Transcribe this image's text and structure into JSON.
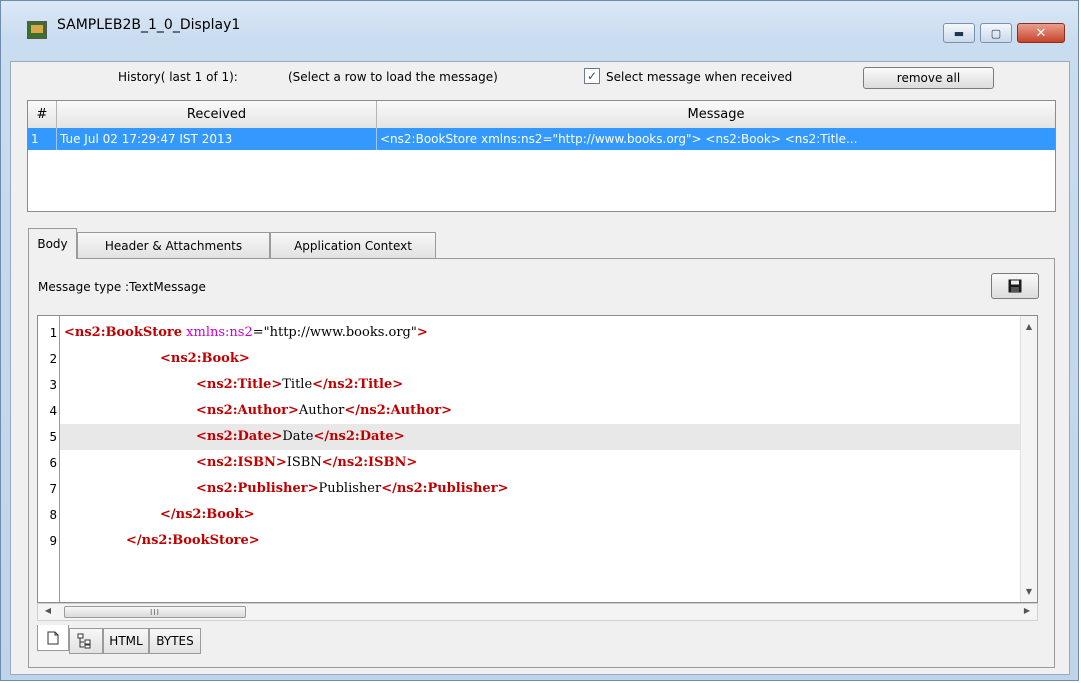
{
  "window": {
    "title": "SAMPLEB2B_1_0_Display1",
    "controls": {
      "minimize_icon": "minimize-icon",
      "maximize_icon": "maximize-icon",
      "close_icon": "close-icon"
    }
  },
  "history": {
    "label": "History( last 1 of 1):",
    "hint": "(Select a row to load the message)",
    "select_when_received_label": "Select message when received",
    "select_when_received_checked": true,
    "remove_all_label": "remove all"
  },
  "table": {
    "columns": [
      "#",
      "Received",
      "Message"
    ],
    "rows": [
      {
        "num": "1",
        "received": "Tue Jul 02 17:29:47 IST 2013",
        "message": "<ns2:BookStore xmlns:ns2=\"http://www.books.org\">      <ns2:Book>        <ns2:Title..."
      }
    ],
    "selected_row": 0
  },
  "tabs": [
    {
      "label": "Body",
      "active": true
    },
    {
      "label": "Header & Attachments",
      "active": false
    },
    {
      "label": "Application Context",
      "active": false
    }
  ],
  "body": {
    "message_type": "Message type :TextMessage",
    "save_icon": "floppy-disk-icon"
  },
  "editor": {
    "line_numbers": [
      "1",
      "2",
      "3",
      "4",
      "5",
      "6",
      "7",
      "8",
      "9"
    ],
    "highlighted_line": 5,
    "lines": {
      "l1": {
        "open": "<ns2:BookStore",
        "attr": " xmlns:ns2",
        "eq": "=",
        "val": "\"http://www.books.org\"",
        "close": ">"
      },
      "l2": {
        "tag": "<ns2:Book>"
      },
      "l3": {
        "open": "<ns2:Title>",
        "text": "Title",
        "close": "</ns2:Title>"
      },
      "l4": {
        "open": "<ns2:Author>",
        "text": "Author",
        "close": "</ns2:Author>"
      },
      "l5": {
        "open": "<ns2:Date>",
        "text": "Date",
        "close": "</ns2:Date>"
      },
      "l6": {
        "open": "<ns2:ISBN>",
        "text": "ISBN",
        "close": "</ns2:ISBN>"
      },
      "l7": {
        "open": "<ns2:Publisher>",
        "text": "Publisher",
        "close": "</ns2:Publisher>"
      },
      "l8": {
        "tag": "</ns2:Book>"
      },
      "l9": {
        "tag": "</ns2:BookStore>"
      }
    },
    "hscroll_grip": "III"
  },
  "bottom_tabs": [
    {
      "icon": "document-icon",
      "active": true
    },
    {
      "icon": "tree-view-icon",
      "active": false
    },
    {
      "label": "HTML",
      "active": false
    },
    {
      "label": "BYTES",
      "active": false
    }
  ]
}
